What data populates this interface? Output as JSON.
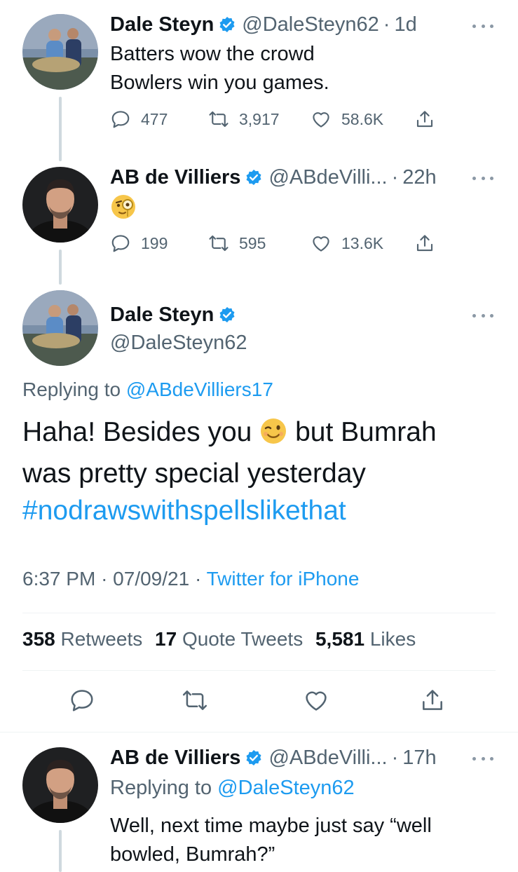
{
  "tweet1": {
    "name": "Dale Steyn",
    "handle": "@DaleSteyn62",
    "separator": "·",
    "time": "1d",
    "text_line1": "Batters wow the crowd",
    "text_line2": "Bowlers win you games.",
    "replies": "477",
    "retweets": "3,917",
    "likes": "58.6K"
  },
  "tweet2": {
    "name": "AB de Villiers",
    "handle": "@ABdeVilli...",
    "separator": "·",
    "time": "22h",
    "emoji": "🧐",
    "replies": "199",
    "retweets": "595",
    "likes": "13.6K"
  },
  "main_tweet": {
    "name": "Dale Steyn",
    "handle": "@DaleSteyn62",
    "replying_label": "Replying to",
    "replying_handle": "@ABdeVilliers17",
    "text_part1": "Haha! Besides you",
    "text_part2": "but Bumrah",
    "text_line2": "was pretty special yesterday",
    "hashtag": "#nodrawswithspellslikethat",
    "time": "6:37 PM",
    "date": "07/09/21",
    "separator": "·",
    "client": "Twitter for iPhone",
    "retweets_count": "358",
    "retweets_label": "Retweets",
    "quote_count": "17",
    "quote_label": "Quote Tweets",
    "likes_count": "5,581",
    "likes_label": "Likes"
  },
  "tweet4": {
    "name": "AB de Villiers",
    "handle": "@ABdeVilli...",
    "separator": "·",
    "time": "17h",
    "replying_label": "Replying to",
    "replying_handle": "@DaleSteyn62",
    "text_line1": "Well, next time maybe just say “well",
    "text_line2": "bowled, Bumrah?”"
  },
  "icons": {
    "reply": "reply-icon",
    "retweet": "retweet-icon",
    "like": "heart-icon",
    "share": "share-icon",
    "verified": "verified-badge-icon",
    "more": "more-icon"
  },
  "colors": {
    "accent": "#1d9bf0",
    "text": "#0f1419",
    "secondary": "#536471",
    "thread_line": "#cfd9de"
  }
}
